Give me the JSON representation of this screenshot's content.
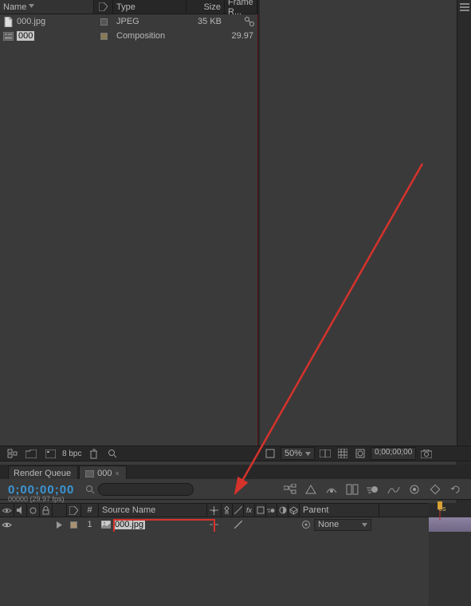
{
  "project": {
    "columns": {
      "name": "Name",
      "type": "Type",
      "size": "Size",
      "frame_rate": "Frame R..."
    },
    "items": [
      {
        "name": "000.jpg",
        "type": "JPEG",
        "size": "35 KB",
        "frame_rate": "",
        "icon": "file-icon",
        "selected": false
      },
      {
        "name": "000",
        "type": "Composition",
        "size": "",
        "frame_rate": "29.97",
        "icon": "comp-icon",
        "selected": true
      }
    ],
    "footer": {
      "bpc": "8 bpc"
    }
  },
  "preview": {
    "zoom": "50%",
    "timecode": "0;00;00;00"
  },
  "tabs": [
    {
      "label": "Render Queue",
      "active": false,
      "closable": false
    },
    {
      "label": "000",
      "active": true,
      "closable": true,
      "icon": "comp-icon"
    }
  ],
  "timeline": {
    "timecode": "0;00;00;00",
    "subtime": "00000 (29.97 fps)",
    "search_placeholder": "",
    "headers": {
      "num": "#",
      "source": "Source Name",
      "parent": "Parent"
    },
    "layers": [
      {
        "num": "1",
        "name": "000.jpg",
        "parent": "None",
        "icon": "image-icon"
      }
    ],
    "ruler_label": "0s"
  },
  "colors": {
    "red": "#d6322c",
    "tc_blue": "#3a96d6"
  }
}
